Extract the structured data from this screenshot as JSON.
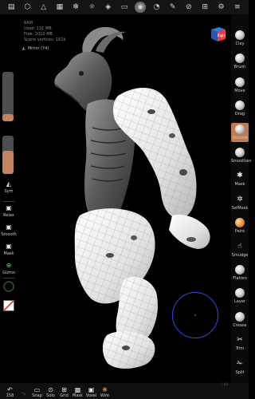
{
  "topbar": {
    "icons": [
      "files-icon",
      "scene-icon",
      "topology-icon",
      "mesh-icon",
      "settings-gear-icon",
      "sun-icon",
      "render-icon",
      "camera-icon",
      "matcap-sphere-icon",
      "brush-stroke-icon",
      "pen-icon",
      "picker-icon",
      "grid-icon",
      "gear-icon",
      "overflow-icon"
    ]
  },
  "info": {
    "line1": "RAM",
    "line2": "Used: 131 MB",
    "line3": "Free: 2010 MB",
    "line4": "Scene vertices: 162k"
  },
  "mirror": {
    "label": "Mirror (Y4)"
  },
  "view_cube": {
    "label": "Right"
  },
  "left_panel": {
    "radius_fill_pct": 14,
    "intensity_fill_pct": 60,
    "items": [
      {
        "label": "Sym",
        "icon": "symmetry-icon"
      },
      {
        "label": "Relax",
        "icon": "relax-icon"
      },
      {
        "label": "Smooth",
        "icon": "smooth-icon"
      },
      {
        "label": "Mask",
        "icon": "mask-icon"
      },
      {
        "label": "Gizmo",
        "icon": "gizmo-icon"
      }
    ]
  },
  "right_tools": [
    {
      "label": "Clay",
      "kind": "ball"
    },
    {
      "label": "Brush",
      "kind": "ball"
    },
    {
      "label": "Move",
      "kind": "ball"
    },
    {
      "label": "Drag",
      "kind": "ball"
    },
    {
      "label": "Smooth",
      "kind": "ball",
      "active": true
    },
    {
      "label": "Smoothen",
      "kind": "ball"
    },
    {
      "label": "Mask",
      "kind": "glyph"
    },
    {
      "label": "SelMask",
      "kind": "glyph"
    },
    {
      "label": "Paint",
      "kind": "ball-orange"
    },
    {
      "label": "Smudge",
      "kind": "glyph"
    },
    {
      "label": "Flatten",
      "kind": "ball"
    },
    {
      "label": "Layer",
      "kind": "ball"
    },
    {
      "label": "Crease",
      "kind": "ball"
    },
    {
      "label": "Trim",
      "kind": "glyph"
    },
    {
      "label": "Split",
      "kind": "glyph"
    }
  ],
  "bottombar": {
    "undo_count": "158",
    "items": [
      {
        "label": "",
        "icon": "redo-icon"
      },
      {
        "label": "Snap",
        "icon": "snap-icon"
      },
      {
        "label": "Solo",
        "icon": "solo-icon"
      },
      {
        "label": "Grid",
        "icon": "grid-icon"
      },
      {
        "label": "Mask",
        "icon": "mask-icon"
      },
      {
        "label": "Voxel",
        "icon": "voxel-icon"
      },
      {
        "label": "Wire",
        "icon": "wire-icon"
      }
    ]
  },
  "version": "1.68",
  "colors": {
    "accent": "#c07a50",
    "cursor": "#2f49e0",
    "background": "#000000"
  }
}
